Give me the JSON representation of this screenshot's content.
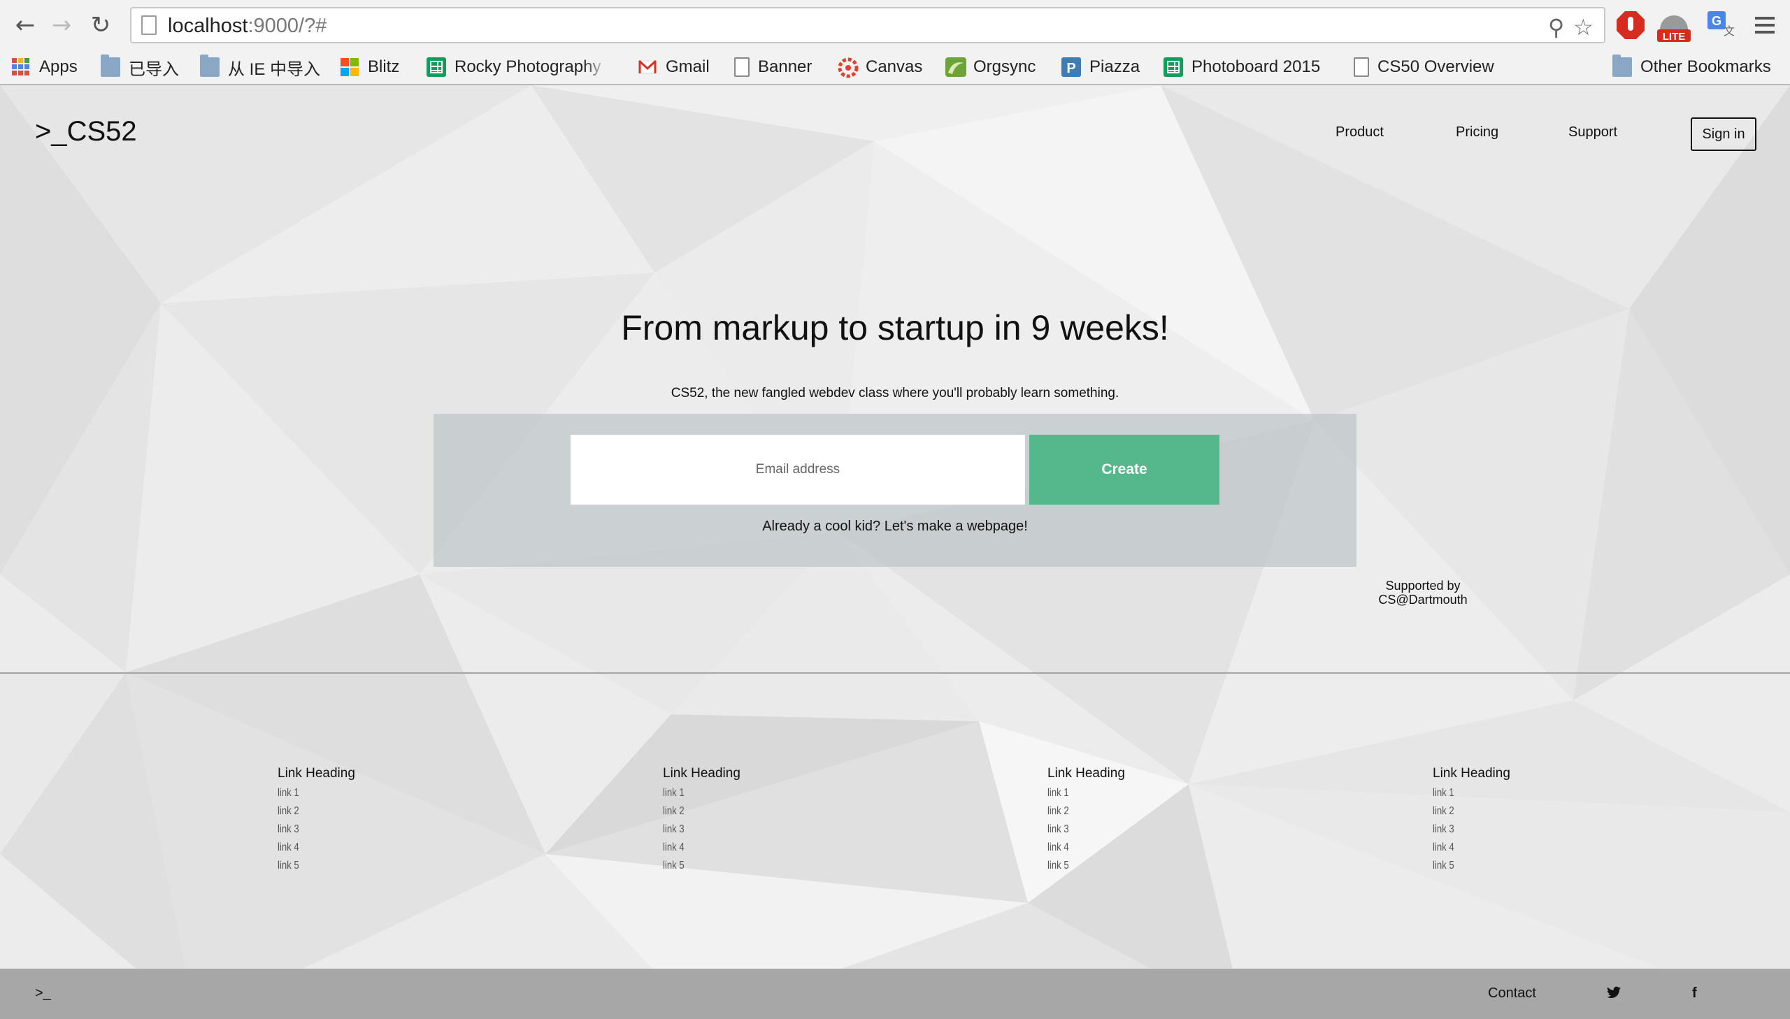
{
  "browser": {
    "url_host": "localhost",
    "url_rest": ":9000/?#",
    "bookmarks": [
      {
        "label": "Apps",
        "icon": "apps-grid-icon"
      },
      {
        "label": "已导入",
        "icon": "folder-icon"
      },
      {
        "label": "从 IE 中导入",
        "icon": "folder-icon"
      },
      {
        "label": "Blitz",
        "icon": "microsoft-logo-icon"
      },
      {
        "label": "Rocky Photography S",
        "icon": "spreadsheet-icon"
      },
      {
        "label": "Gmail",
        "icon": "gmail-icon"
      },
      {
        "label": "Banner",
        "icon": "document-icon"
      },
      {
        "label": "Canvas",
        "icon": "canvas-icon"
      },
      {
        "label": "Orgsync",
        "icon": "orgsync-icon"
      },
      {
        "label": "Piazza",
        "icon": "piazza-icon"
      },
      {
        "label": "Photoboard 2015",
        "icon": "spreadsheet-icon"
      },
      {
        "label": "CS50 Overview",
        "icon": "document-icon"
      },
      {
        "label": "Other Bookmarks",
        "icon": "folder-icon"
      }
    ],
    "extensions": {
      "lite_badge": "LITE"
    }
  },
  "site": {
    "brand": ">_CS52",
    "nav": {
      "product": "Product",
      "pricing": "Pricing",
      "support": "Support",
      "signin": "Sign in"
    },
    "hero": {
      "title": "From markup to startup in 9 weeks!",
      "subtitle": "CS52, the new fangled webdev class where you'll probably learn something.",
      "email_placeholder": "Email address",
      "create_label": "Create",
      "already": "Already a cool kid? Let's make a webpage!"
    },
    "supported_by": {
      "line1": "Supported by",
      "line2": "CS@Dartmouth"
    },
    "link_columns": [
      {
        "heading": "Link Heading",
        "links": [
          "link 1",
          "link 2",
          "link 3",
          "link 4",
          "link 5"
        ]
      },
      {
        "heading": "Link Heading",
        "links": [
          "link 1",
          "link 2",
          "link 3",
          "link 4",
          "link 5"
        ]
      },
      {
        "heading": "Link Heading",
        "links": [
          "link 1",
          "link 2",
          "link 3",
          "link 4",
          "link 5"
        ]
      },
      {
        "heading": "Link Heading",
        "links": [
          "link 1",
          "link 2",
          "link 3",
          "link 4",
          "link 5"
        ]
      }
    ],
    "footer": {
      "prompt": ">_",
      "contact": "Contact",
      "twitter_glyph": "🐦",
      "facebook_glyph": "f"
    }
  },
  "colors": {
    "accent": "#55b88d",
    "footer": "#a7a7a7",
    "signup_panel": "#c6cbcc"
  }
}
